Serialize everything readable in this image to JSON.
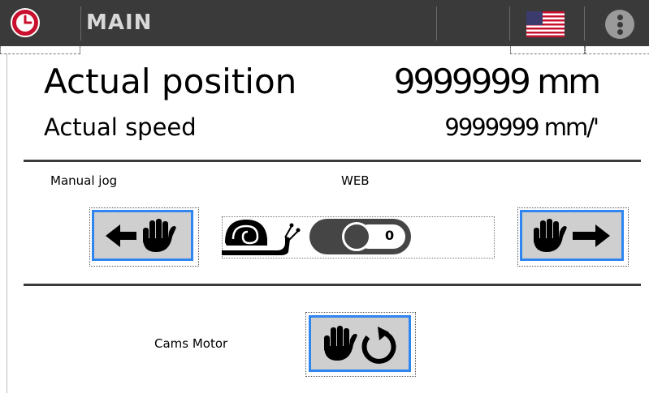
{
  "header": {
    "title": "MAIN",
    "icons": {
      "clock": "clock-icon",
      "flag": "us-flag-icon",
      "info": "more-icon"
    },
    "accent_clock": "#c8102e",
    "bar_color": "#3a3a3a"
  },
  "position": {
    "actual_position_label": "Actual position",
    "actual_position_value": "9999999 mm",
    "actual_speed_label": "Actual speed",
    "actual_speed_value": "9999999 mm/'"
  },
  "jog": {
    "manual_jog_label": "Manual jog",
    "web_label": "WEB",
    "toggle_value": "0",
    "left_button_icon": "jog-left-icon",
    "right_button_icon": "jog-right-icon",
    "slow_icon": "snail-icon"
  },
  "cams": {
    "cams_motor_label": "Cams Motor",
    "button_icon": "hand-rotate-icon"
  },
  "colors": {
    "button_border": "#2f86f0",
    "button_fill": "#cfcfcf"
  }
}
